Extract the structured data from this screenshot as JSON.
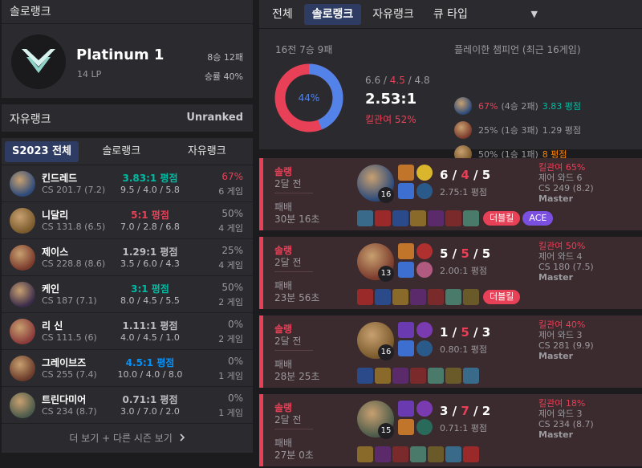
{
  "solo": {
    "title": "솔로랭크",
    "tier": "Platinum 1",
    "lp": "14 LP",
    "record": "8승 12패",
    "winrate": "승률 40%"
  },
  "flex": {
    "title": "자유랭크",
    "value": "Unranked"
  },
  "season": {
    "tabs": [
      "S2023 전체",
      "솔로랭크",
      "자유랭크"
    ],
    "champions": [
      {
        "name": "킨드레드",
        "cs": "CS 201.7 (7.2)",
        "kda": "3.83:1 평점",
        "kda_detail": "9.5 / 4.0 / 5.8",
        "winrate": "67%",
        "games": "6 게임",
        "kda_color": "#00bba3",
        "wr_color": "#e84057"
      },
      {
        "name": "니달리",
        "cs": "CS 131.8 (6.5)",
        "kda": "5:1 평점",
        "kda_detail": "7.0 / 2.8 / 6.8",
        "winrate": "50%",
        "games": "4 게임",
        "kda_color": "#e84057",
        "wr_color": "#9a9a9e"
      },
      {
        "name": "제이스",
        "cs": "CS 228.8 (8.6)",
        "kda": "1.29:1 평점",
        "kda_detail": "3.5 / 6.0 / 4.3",
        "winrate": "25%",
        "games": "4 게임",
        "kda_color": "#bcbcc0",
        "wr_color": "#9a9a9e"
      },
      {
        "name": "케인",
        "cs": "CS 187 (7.1)",
        "kda": "3:1 평점",
        "kda_detail": "8.0 / 4.5 / 5.5",
        "winrate": "50%",
        "games": "2 게임",
        "kda_color": "#00bba3",
        "wr_color": "#9a9a9e"
      },
      {
        "name": "리 신",
        "cs": "CS 111.5 (6)",
        "kda": "1.11:1 평점",
        "kda_detail": "4.0 / 4.5 / 1.0",
        "winrate": "0%",
        "games": "2 게임",
        "kda_color": "#bcbcc0",
        "wr_color": "#9a9a9e"
      },
      {
        "name": "그레이브즈",
        "cs": "CS 255 (7.4)",
        "kda": "4.5:1 평점",
        "kda_detail": "10.0 / 4.0 / 8.0",
        "winrate": "0%",
        "games": "1 게임",
        "kda_color": "#0093ff",
        "wr_color": "#9a9a9e"
      },
      {
        "name": "트린다미어",
        "cs": "CS 234 (8.7)",
        "kda": "0.71:1 평점",
        "kda_detail": "3.0 / 7.0 / 2.0",
        "winrate": "0%",
        "games": "1 게임",
        "kda_color": "#bcbcc0",
        "wr_color": "#9a9a9e"
      }
    ],
    "more_label": "더 보기 + 다른 시즌 보기"
  },
  "tabs": [
    "전체",
    "솔로랭크",
    "자유랭크",
    "큐 타입"
  ],
  "summary": {
    "title": "16전 7승 9패",
    "winrate_label": "44%",
    "win_fraction": 0.4375,
    "kda_k": "6.6",
    "kda_d": "4.5",
    "kda_a": "4.8",
    "ratio": "2.53:1",
    "kill_participation": "킬관여 52%",
    "played_title": "플레이한 챔피언 (최근 16게임)",
    "played": [
      {
        "wr": "67%",
        "record": "(4승 2패)",
        "kda": "3.83 평점",
        "wr_color": "#e84057",
        "kda_color": "#00bba3"
      },
      {
        "wr": "25%",
        "record": "(1승 3패)",
        "kda": "1.29 평점",
        "wr_color": "#9a9a9e",
        "kda_color": "#9a9a9e"
      },
      {
        "wr": "50%",
        "record": "(1승 1패)",
        "kda": "8 평점",
        "wr_color": "#9a9a9e",
        "kda_color": "#ff8200"
      }
    ]
  },
  "matches": [
    {
      "type": "솔랭",
      "ago": "2달 전",
      "result": "패배",
      "duration": "30분 16초",
      "level": "16",
      "k": "6",
      "d": "4",
      "a": "5",
      "ratio": "2.75:1 평점",
      "kp": "킬관여 65%",
      "wards": "제어 와드 6",
      "cs": "CS 249 (8.2)",
      "tier": "Master",
      "badges": [
        "더블킬",
        "ACE"
      ]
    },
    {
      "type": "솔랭",
      "ago": "2달 전",
      "result": "패배",
      "duration": "23분 56초",
      "level": "13",
      "k": "5",
      "d": "5",
      "a": "5",
      "ratio": "2.00:1 평점",
      "kp": "킬관여 50%",
      "wards": "제어 와드 4",
      "cs": "CS 180 (7.5)",
      "tier": "Master",
      "badges": [
        "더블킬"
      ]
    },
    {
      "type": "솔랭",
      "ago": "2달 전",
      "result": "패배",
      "duration": "28분 25초",
      "level": "16",
      "k": "1",
      "d": "5",
      "a": "3",
      "ratio": "0.80:1 평점",
      "kp": "킬관여 40%",
      "wards": "제어 와드 3",
      "cs": "CS 281 (9.9)",
      "tier": "Master",
      "badges": []
    },
    {
      "type": "솔랭",
      "ago": "2달 전",
      "result": "패배",
      "duration": "27분 0초",
      "level": "15",
      "k": "3",
      "d": "7",
      "a": "2",
      "ratio": "0.71:1 평점",
      "kp": "킬관여 18%",
      "wards": "제어 와드 3",
      "cs": "CS 234 (8.7)",
      "tier": "Master",
      "badges": []
    }
  ],
  "colors": {
    "accent": "#2e3b62",
    "loss": "#e84057",
    "win": "#5383e8",
    "panel": "#2b2b2f",
    "match_bg": "#3b2a2e"
  },
  "icons": [
    "chevron-right-icon",
    "caret-down-icon",
    "platinum-emblem-icon"
  ]
}
